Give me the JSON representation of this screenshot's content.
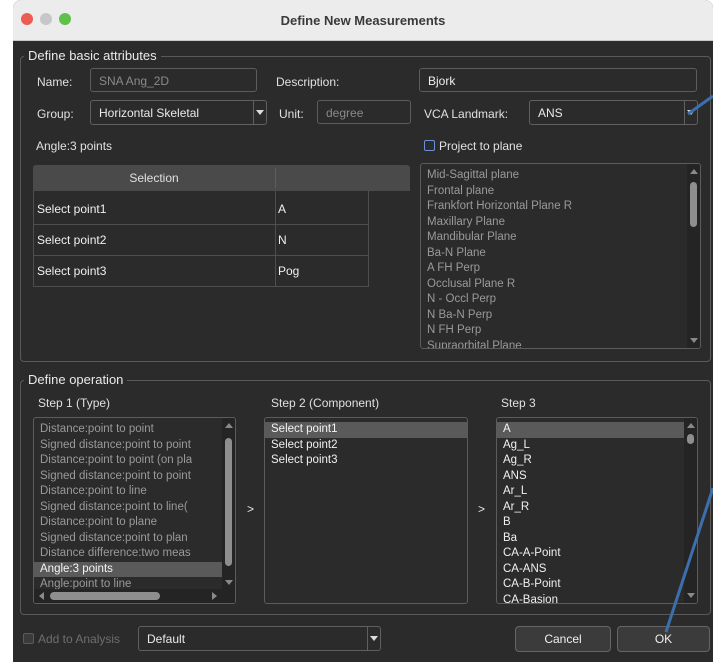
{
  "window": {
    "title": "Define New Measurements"
  },
  "basic": {
    "section_title": "Define basic attributes",
    "name_label": "Name:",
    "name_value": "SNA Ang_2D",
    "description_label": "Description:",
    "description_value": "Bjork",
    "group_label": "Group:",
    "group_value": "Horizontal Skeletal",
    "unit_label": "Unit:",
    "unit_value": "degree",
    "vca_label": "VCA Landmark:",
    "vca_value": "ANS",
    "angle_label": "Angle:3 points",
    "project_label": "Project to plane"
  },
  "selection_table": {
    "header": "Selection",
    "rows": [
      {
        "step": "Select point1",
        "value": "A"
      },
      {
        "step": "Select point2",
        "value": "N"
      },
      {
        "step": "Select point3",
        "value": "Pog"
      }
    ]
  },
  "planes": [
    "Mid-Sagittal plane",
    "Frontal plane",
    "Frankfort Horizontal Plane R",
    "Maxillary Plane",
    "Mandibular Plane",
    "Ba-N Plane",
    "A FH Perp",
    "Occlusal Plane R",
    "N - Occl Perp",
    "N Ba-N Perp",
    "N FH Perp",
    "Supraorbital Plane"
  ],
  "operation": {
    "section_title": "Define operation",
    "step1_label": "Step 1 (Type)",
    "step2_label": "Step 2 (Component)",
    "step3_label": "Step 3",
    "arrow1": ">",
    "arrow2": ">",
    "step1_items": [
      "Distance:point to point",
      "Signed distance:point to point",
      "Distance:point to point (on pla",
      "Signed distance:point to point",
      "Distance:point to line",
      "Signed distance:point to line(",
      "Distance:point to plane",
      "Signed distance:point to plan",
      "Distance difference:two meas",
      "Angle:3 points",
      "Angle:point to line"
    ],
    "step1_selected": "Angle:3 points",
    "step2_items": [
      "Select point1",
      "Select point2",
      "Select point3"
    ],
    "step2_selected": "Select point1",
    "step3_items": [
      "A",
      "Ag_L",
      "Ag_R",
      "ANS",
      "Ar_L",
      "Ar_R",
      "B",
      "Ba",
      "CA-A-Point",
      "CA-ANS",
      "CA-B-Point",
      "CA-Basion"
    ],
    "step3_selected": "A"
  },
  "footer": {
    "add_label": "Add to Analysis",
    "analysis_value": "Default",
    "cancel": "Cancel",
    "ok": "OK"
  },
  "colors": {
    "traffic_red": "#ee5b52",
    "traffic_yellow": "#c7c7c7",
    "traffic_green": "#5fc149",
    "annotation_line": "#3c6fae"
  }
}
